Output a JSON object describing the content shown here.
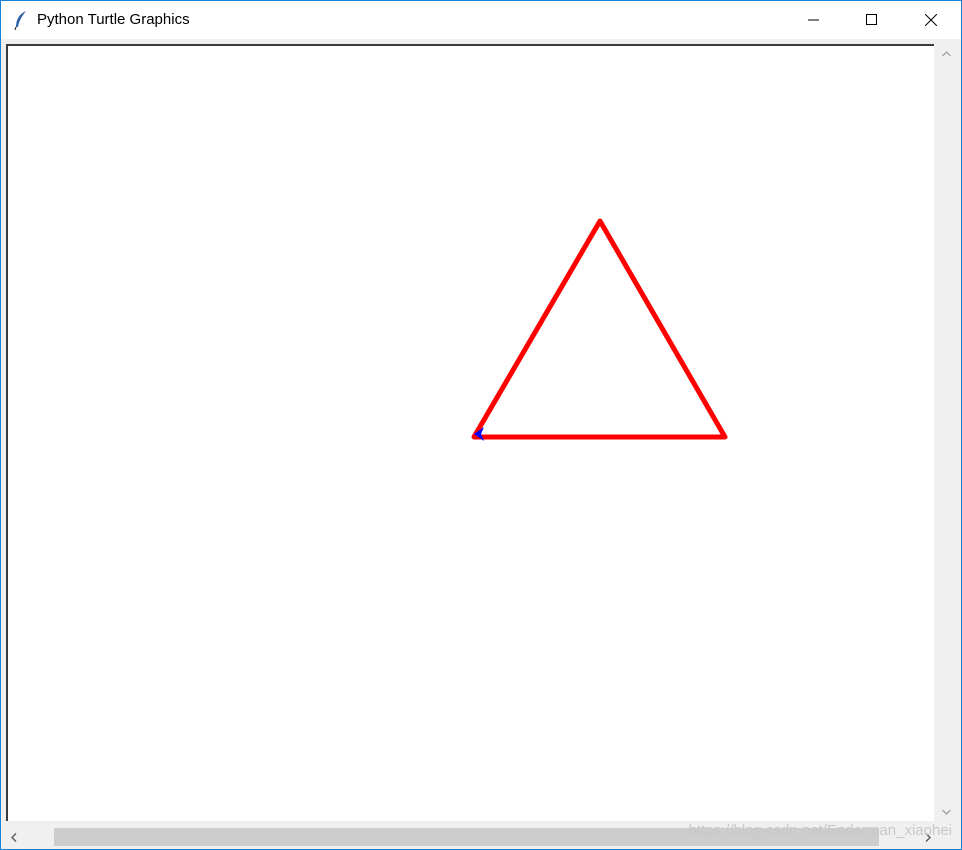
{
  "window": {
    "title": "Python Turtle Graphics",
    "app_icon": "feather-icon",
    "controls": [
      "minimize-icon",
      "maximize-icon",
      "close-icon"
    ]
  },
  "canvas": {
    "background": "#ffffff",
    "shapes": [
      {
        "type": "triangle",
        "stroke": "#ff0000",
        "fill": "none"
      }
    ],
    "turtle": {
      "shape": "arrow",
      "color": "#0000ff",
      "heading": "west"
    }
  },
  "scrollbars": {
    "vertical_arrows": [
      "chevron-up-icon",
      "chevron-down-icon"
    ],
    "horizontal_arrows": [
      "chevron-left-icon",
      "chevron-right-icon"
    ]
  },
  "watermark": "https://blog.csdn.net/Enderman_xiaohei"
}
